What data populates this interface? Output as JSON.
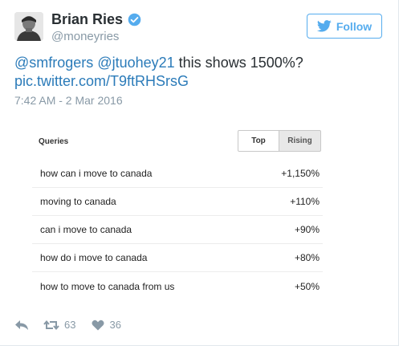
{
  "author": {
    "name": "Brian Ries",
    "handle": "@moneyries",
    "verified": true
  },
  "follow": {
    "label": "Follow"
  },
  "tweet": {
    "mention1": "@smfrogers",
    "mention2": "@jtuohey21",
    "text": "this shows 1500%?",
    "link": "pic.twitter.com/T9ftRHSrsG",
    "timestamp": "7:42 AM - 2 Mar 2016"
  },
  "trends": {
    "header": "Queries",
    "tabs": {
      "top": "Top",
      "rising": "Rising",
      "selected": "Rising"
    },
    "rows": [
      {
        "query": "how can i move to canada",
        "value": "+1,150%"
      },
      {
        "query": "moving to canada",
        "value": "+110%"
      },
      {
        "query": "can i move to canada",
        "value": "+90%"
      },
      {
        "query": "how do i move to canada",
        "value": "+80%"
      },
      {
        "query": "how to move to canada from us",
        "value": "+50%"
      }
    ]
  },
  "actions": {
    "retweets": "63",
    "likes": "36"
  },
  "colors": {
    "accent": "#55acee",
    "link": "#2b7bb9",
    "muted": "#8899a6"
  }
}
